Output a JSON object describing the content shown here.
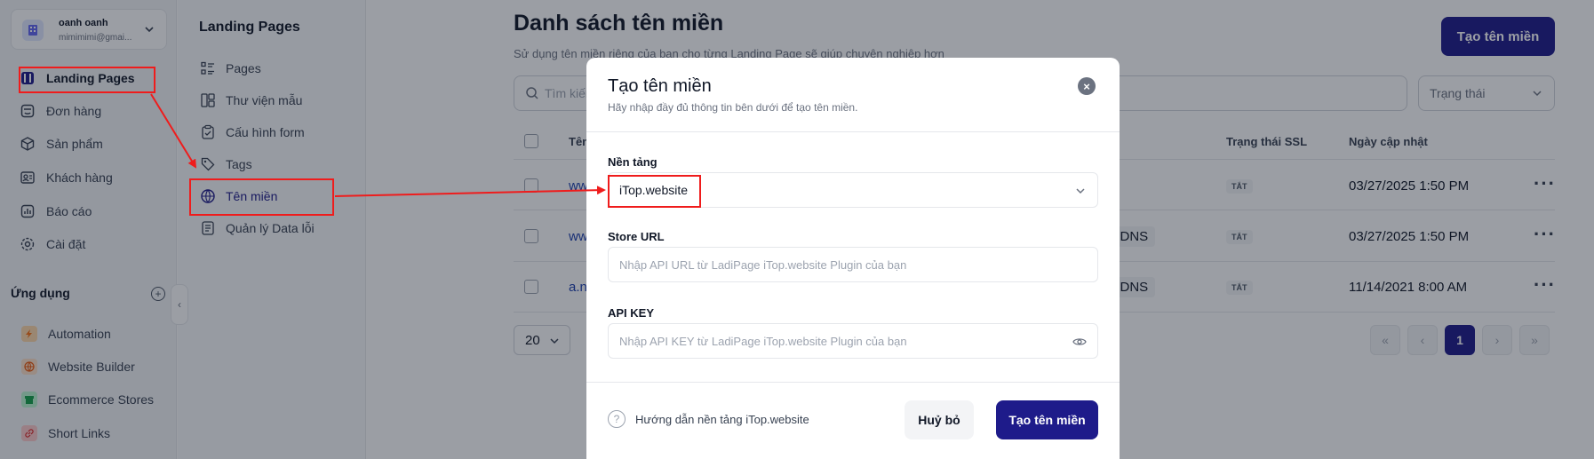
{
  "account": {
    "name": "oanh oanh",
    "email": "mimimimi@gmai..."
  },
  "sidebar": {
    "items": [
      {
        "label": "Landing Pages",
        "icon": "landing-pages-icon",
        "active": true
      },
      {
        "label": "Đơn hàng",
        "icon": "orders-icon"
      },
      {
        "label": "Sản phẩm",
        "icon": "box-icon"
      },
      {
        "label": "Khách hàng",
        "icon": "contacts-icon"
      },
      {
        "label": "Báo cáo",
        "icon": "chart-icon"
      },
      {
        "label": "Cài đặt",
        "icon": "gear-icon"
      }
    ],
    "apps_title": "Ứng dụng",
    "apps": [
      {
        "label": "Automation",
        "icon": "bolt-icon",
        "color": "#f97316"
      },
      {
        "label": "Website Builder",
        "icon": "globe-icon",
        "color": "#ea580c"
      },
      {
        "label": "Ecommerce Stores",
        "icon": "store-icon",
        "color": "#16a34a"
      },
      {
        "label": "Short Links",
        "icon": "link-icon",
        "color": "#dc2626"
      }
    ]
  },
  "subnav": {
    "title": "Landing Pages",
    "items": [
      {
        "label": "Pages",
        "icon": "list-icon"
      },
      {
        "label": "Thư viện mẫu",
        "icon": "template-icon"
      },
      {
        "label": "Cấu hình form",
        "icon": "clipboard-icon"
      },
      {
        "label": "Tags",
        "icon": "tag-icon"
      },
      {
        "label": "Tên miền",
        "icon": "www-globe-icon",
        "active": true
      },
      {
        "label": "Quản lý Data lỗi",
        "icon": "document-icon"
      }
    ]
  },
  "main": {
    "title": "Danh sách tên miền",
    "subtitle": "Sử dụng tên miền riêng của bạn cho từng Landing Page sẽ giúp chuyên nghiệp hơn",
    "create_button": "Tạo tên miền",
    "search_placeholder": "Tìm kiếm",
    "status_filter": "Trạng thái",
    "columns": {
      "name": "Tên",
      "ssl": "Trạng thái SSL",
      "updated": "Ngày cập nhật"
    },
    "rows": [
      {
        "name": "ww",
        "dns": "",
        "ssl": "TẮT",
        "updated": "03/27/2025 1:50 PM"
      },
      {
        "name": "ww",
        "dns": "d DNS",
        "ssl": "TẮT",
        "updated": "03/27/2025 1:50 PM"
      },
      {
        "name": "a.n",
        "dns": "d DNS",
        "ssl": "TẮT",
        "updated": "11/14/2021 8:00 AM"
      }
    ],
    "per_page": "20",
    "current_page": "1"
  },
  "modal": {
    "title": "Tạo tên miền",
    "subtitle": "Hãy nhập đầy đủ thông tin bên dưới để tạo tên miền.",
    "platform_label": "Nền tảng",
    "platform_value": "iTop.website",
    "store_url_label": "Store URL",
    "store_url_placeholder": "Nhập API URL từ LadiPage iTop.website Plugin của bạn",
    "api_key_label": "API KEY",
    "api_key_placeholder": "Nhập API KEY từ LadiPage iTop.website Plugin của bạn",
    "help_text": "Hướng dẫn nền tảng iTop.website",
    "cancel_button": "Huỷ bỏ",
    "create_button": "Tạo tên miền"
  },
  "colors": {
    "primary": "#1e1b8a",
    "annotation": "#ef1c1c"
  }
}
